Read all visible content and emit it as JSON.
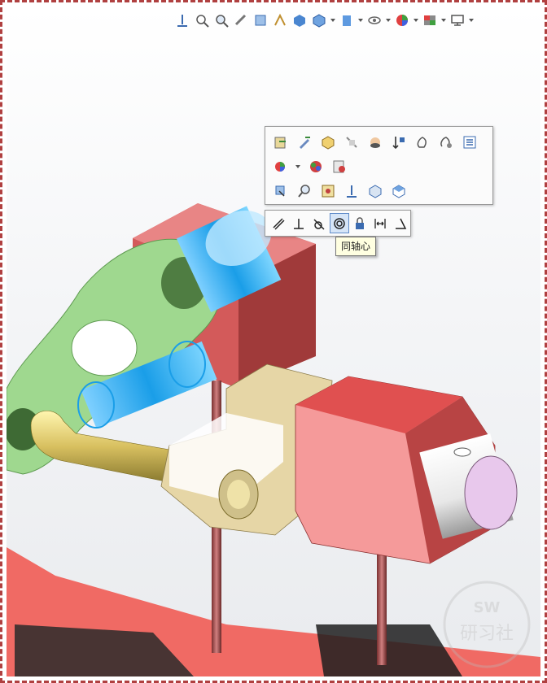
{
  "heads_up_toolbar": {
    "icons": [
      "view-orientation-icon",
      "zoom-to-fit-icon",
      "zoom-to-area-icon",
      "previous-view-icon",
      "section-view-icon",
      "dynamic-annotation-icon",
      "view-cube-icon",
      "display-style-icon",
      "hide-show-icon",
      "edit-appearance-icon",
      "apply-scene-icon",
      "view-settings-icon"
    ]
  },
  "context_toolbar": {
    "row1": [
      "open-part-icon",
      "edit-component-icon",
      "component-properties-icon",
      "hide-component-icon",
      "isolate-icon",
      "mate-icon",
      "change-transparency-icon",
      "hide-show-mates-icon",
      "list-icon"
    ],
    "row2": [
      "appearance-icon",
      "edit-appearance-icon",
      "render-icon"
    ],
    "row3": [
      "insert-component-icon",
      "zoom-to-selection-icon",
      "move-with-triad-icon",
      "normal-to-icon",
      "view-front-icon",
      "view-isometric-icon"
    ]
  },
  "mate_toolbar": {
    "buttons": [
      "parallel-mate-icon",
      "perpendicular-mate-icon",
      "tangent-mate-icon",
      "concentric-mate-icon",
      "lock-mate-icon",
      "distance-mate-icon",
      "angle-mate-icon"
    ],
    "active": "concentric-mate-icon"
  },
  "tooltip": {
    "text": "同轴心"
  },
  "watermark": {
    "text": "SW 研习社"
  },
  "colors": {
    "accent": "#1a9ee8",
    "bracket": "#e06060",
    "link": "#9ad08a",
    "pin": "#d8c878"
  }
}
